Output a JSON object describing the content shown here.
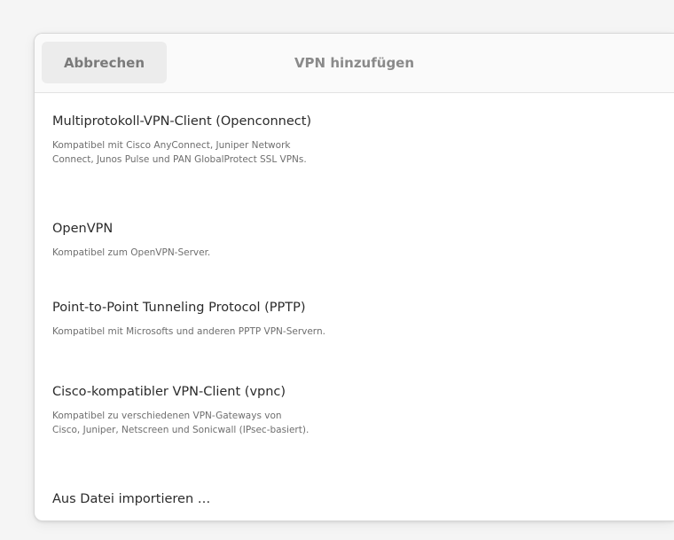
{
  "header": {
    "cancel_label": "Abbrechen",
    "title": "VPN hinzufügen"
  },
  "options": [
    {
      "title": "Multiprotokoll-VPN-Client (Openconnect)",
      "description": "Kompatibel mit Cisco AnyConnect, Juniper Network\nConnect, Junos Pulse und PAN GlobalProtect SSL VPNs."
    },
    {
      "title": "OpenVPN",
      "description": "Kompatibel zum OpenVPN-Server."
    },
    {
      "title": "Point-to-Point Tunneling Protocol (PPTP)",
      "description": "Kompatibel mit Microsofts und anderen PPTP VPN-Servern."
    },
    {
      "title": "Cisco-kompatibler VPN-Client (vpnc)",
      "description": "Kompatibel zu verschiedenen VPN-Gateways von\nCisco, Juniper, Netscreen und Sonicwall (IPsec-basiert)."
    },
    {
      "title": "Aus Datei importieren …"
    }
  ]
}
